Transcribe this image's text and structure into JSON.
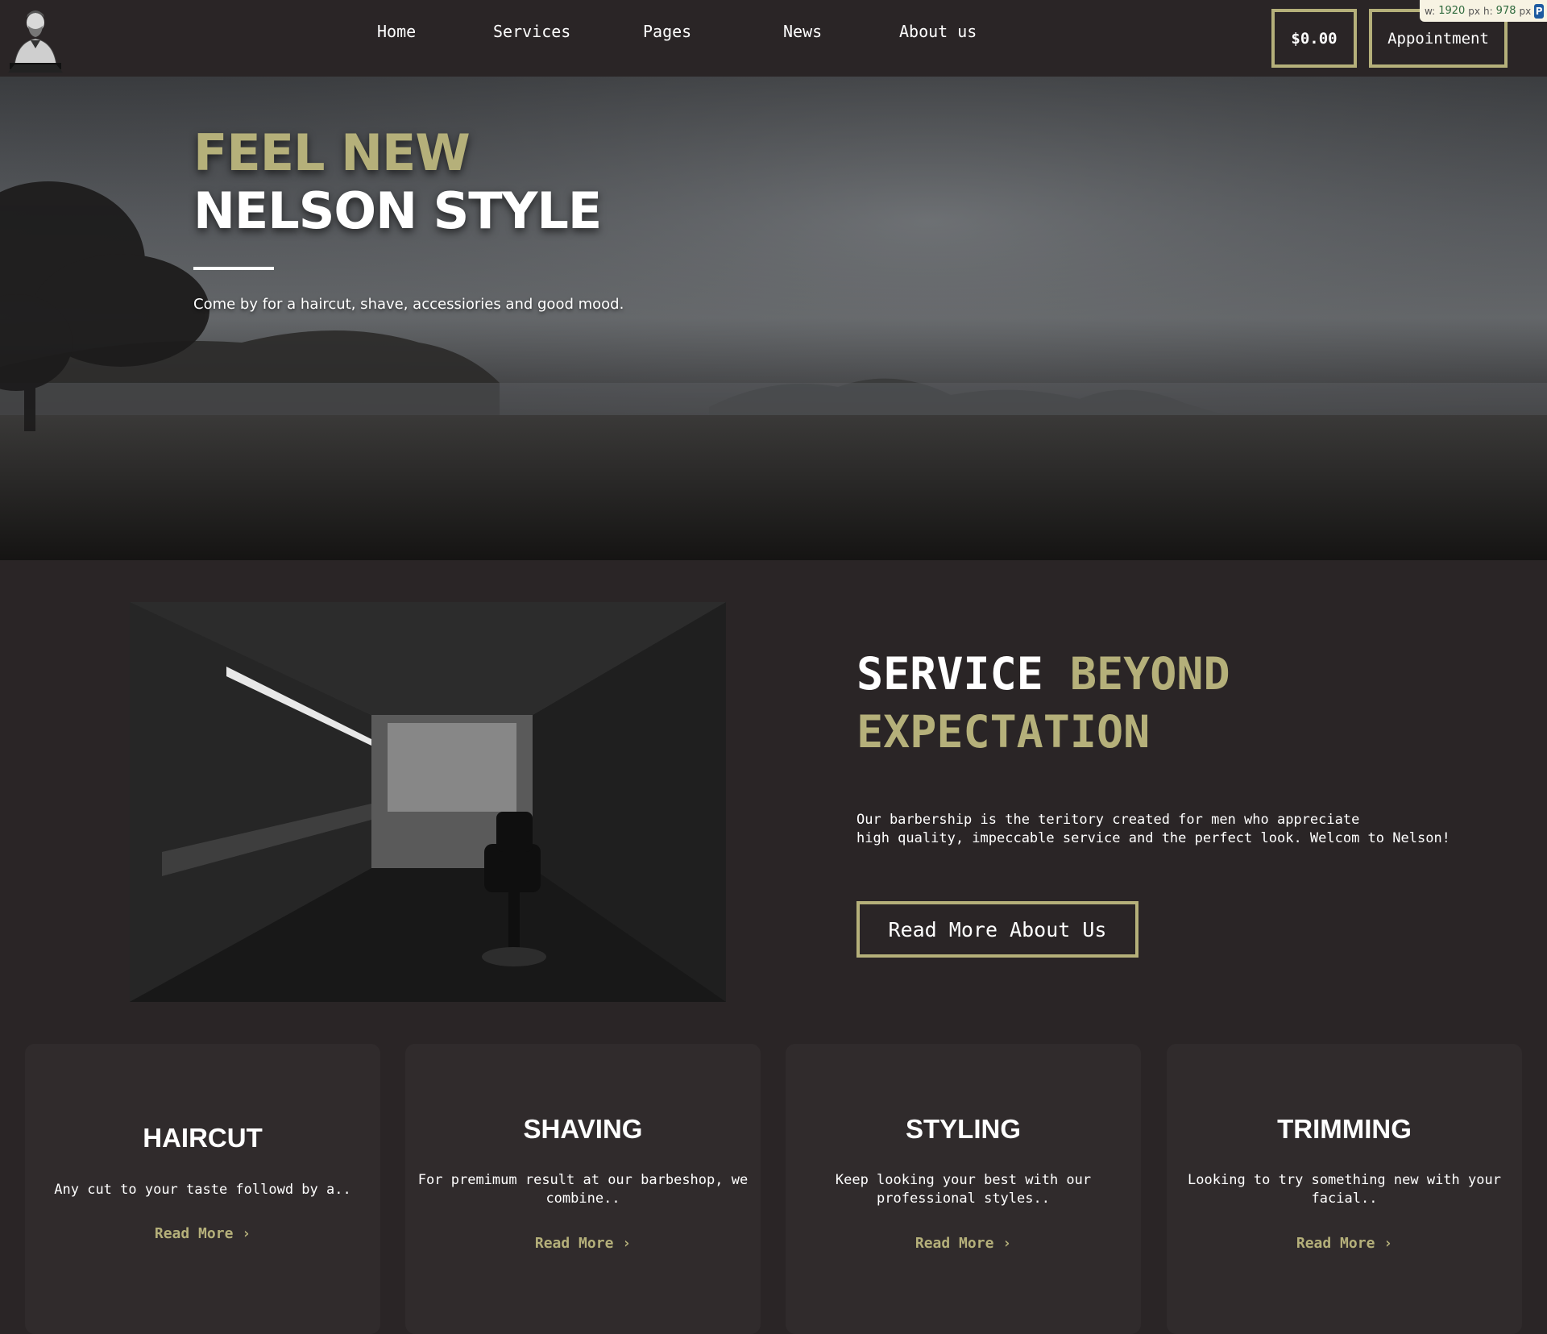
{
  "header": {
    "nav": [
      "Home",
      "Services",
      "Pages",
      "News",
      "About us"
    ],
    "cart_label": "$0.00",
    "appointment_label": "Appointment",
    "logo_icon": "barber-logo-icon"
  },
  "dim_badge": {
    "w_label": "w:",
    "w_value": "1920",
    "w_unit": "px",
    "h_label": "h:",
    "h_value": "978",
    "h_unit": "px"
  },
  "hero": {
    "title_line1": "FEEL NEW",
    "title_line2": "NELSON STYLE",
    "subtitle": "Come by for a haircut, shave, accessiories and good mood."
  },
  "about": {
    "title_white": "SERVICE",
    "title_gold_1": "BEYOND",
    "title_gold_2": "EXPECTATION",
    "text": "Our barbership is the teritory created for men who appreciate\nhigh quality, impeccable service and the perfect look. Welcom to Nelson!",
    "button_label": "Read More About Us"
  },
  "services": [
    {
      "title": "HAIRCUT",
      "text": "Any cut to your taste followd by a..",
      "link": "Read More"
    },
    {
      "title": "SHAVING",
      "text": "For premimum result at our barbeshop, we combine..",
      "link": "Read More"
    },
    {
      "title": "STYLING",
      "text": "Keep looking your best with our professional styles..",
      "link": "Read More"
    },
    {
      "title": "TRIMMING",
      "text": "Looking to try something new with your facial..",
      "link": "Read More"
    }
  ],
  "colors": {
    "background": "#2a2526",
    "card": "#302b2c",
    "accent": "#b5b07a",
    "text": "#ffffff"
  }
}
